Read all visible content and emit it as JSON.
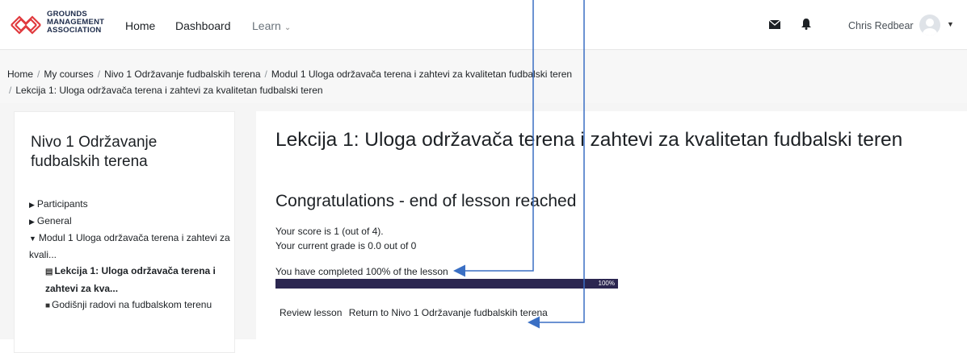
{
  "nav": {
    "logo_lines": [
      "GROUNDS",
      "MANAGEMENT",
      "ASSOCIATION"
    ],
    "home": "Home",
    "dashboard": "Dashboard",
    "learn": "Learn",
    "user_name": "Chris Redbear"
  },
  "breadcrumb": {
    "items": [
      "Home",
      "My courses",
      "Nivo 1 Održavanje fudbalskih terena",
      "Modul 1 Uloga održavača terena i zahtevi za kvalitetan fudbalski teren",
      "Lekcija 1: Uloga održavača terena i zahtevi za kvalitetan fudbalski teren"
    ]
  },
  "sidebar": {
    "title": "Nivo 1 Održavanje fudbalskih terena",
    "items": [
      {
        "label": "Participants"
      },
      {
        "label": "General"
      },
      {
        "label": "Modul 1 Uloga održavača terena i zahtevi za kvali..."
      },
      {
        "label": "Lekcija 1: Uloga održavača terena i zahtevi za kva..."
      },
      {
        "label": "Godišnji radovi na fudbalskom terenu"
      }
    ]
  },
  "main": {
    "title": "Lekcija 1: Uloga održavača terena i zahtevi za kvalitetan fudbalski teren",
    "subtitle": "Congratulations - end of lesson reached",
    "score": "Your score is 1 (out of 4).",
    "grade": "Your current grade is 0.0 out of 0",
    "completed": "You have completed 100% of the lesson",
    "progress_percent": 100,
    "progress_label": "100%",
    "review_link": "Review lesson",
    "return_link": "Return to Nivo 1 Održavanje fudbalskih terena"
  },
  "colors": {
    "progress_fill": "#2b2650",
    "annotation_arrow": "#3a6fc4"
  }
}
